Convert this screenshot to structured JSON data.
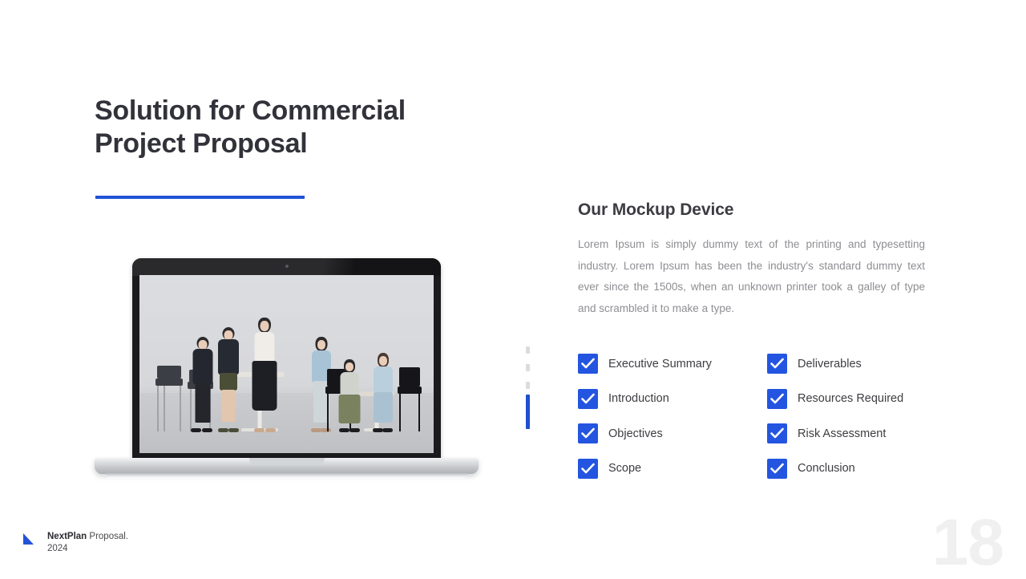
{
  "slide": {
    "title": "Solution for Commercial\nProject Proposal",
    "accent_color": "#2353d6",
    "page_number": "18"
  },
  "mockup": {
    "caption_alt": "laptop-mockup-team-meeting-photo"
  },
  "progress": {
    "dashes": 3,
    "filled": true
  },
  "content": {
    "heading": "Our Mockup Device",
    "paragraph": "Lorem Ipsum is simply dummy text of the printing and typesetting industry.  Lorem Ipsum has been the industry's standard dummy text ever since the 1500s,  when an unknown printer took a galley of type and scrambled it to make a type."
  },
  "checklist": {
    "checkbox_color": "#2355e0",
    "items": [
      {
        "label": "Executive Summary",
        "checked": true
      },
      {
        "label": "Deliverables",
        "checked": true
      },
      {
        "label": "Introduction",
        "checked": true
      },
      {
        "label": "Resources Required",
        "checked": true
      },
      {
        "label": "Objectives",
        "checked": true
      },
      {
        "label": "Risk Assessment",
        "checked": true
      },
      {
        "label": "Scope",
        "checked": true
      },
      {
        "label": "Conclusion",
        "checked": true
      }
    ]
  },
  "footer": {
    "brand": "NextPlan",
    "tagline": " Proposal.\n2024"
  }
}
